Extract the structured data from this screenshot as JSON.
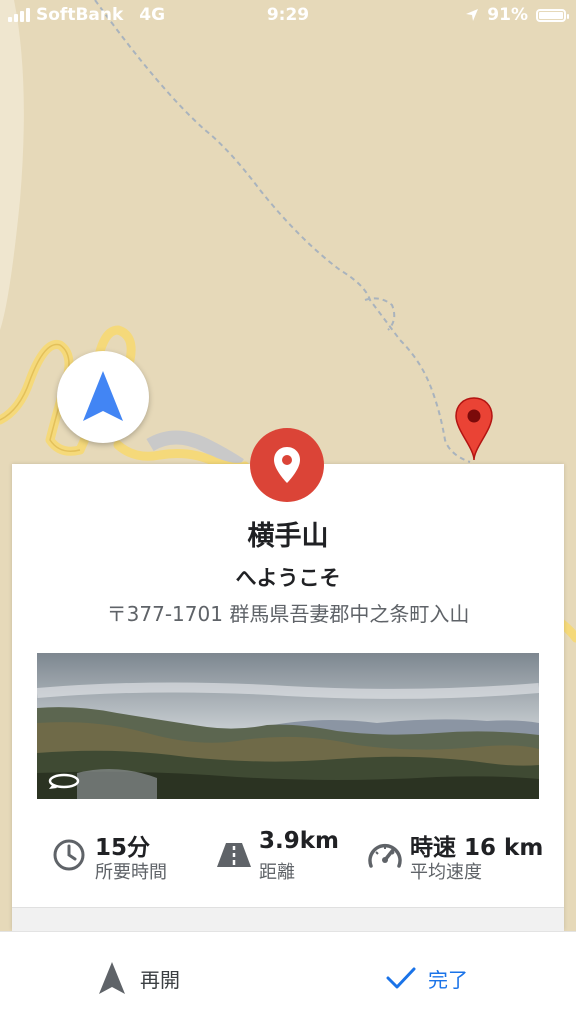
{
  "status_bar": {
    "carrier": "SoftBank",
    "network": "4G",
    "time": "9:29",
    "battery": "91%"
  },
  "place": {
    "name": "横手山",
    "greeting": "へようこそ",
    "address": "〒377-1701 群馬県吾妻郡中之条町入山"
  },
  "stats": {
    "duration_value": "15分",
    "duration_label": "所要時間",
    "distance_value": "3.9km",
    "distance_label": "距離",
    "speed_value": "時速 16 km",
    "speed_label": "平均速度"
  },
  "bottom_bar": {
    "resume_label": "再開",
    "done_label": "完了"
  },
  "colors": {
    "map_background": "#e6d9b9",
    "road": "#f5d97a",
    "pin_red": "#db4437",
    "accent_blue": "#1a73e8",
    "nav_arrow_blue": "#4285f4"
  },
  "icons": [
    "location-arrow-icon",
    "map-pin-icon",
    "place-pin-icon",
    "panorama-rotate-icon",
    "clock-icon",
    "road-icon",
    "speedometer-icon",
    "navigation-arrow-icon",
    "checkmark-icon"
  ]
}
